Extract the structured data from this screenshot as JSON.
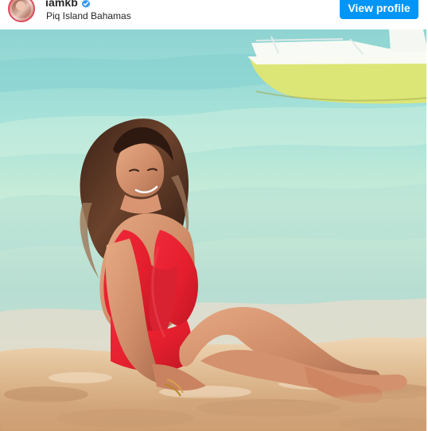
{
  "post": {
    "username": "iamkb",
    "location": "Piq Island Bahamas",
    "view_profile_label": "View profile"
  },
  "icons": {
    "verified": "verified-badge-icon",
    "avatar": "profile-avatar"
  },
  "colors": {
    "primary_button": "#0095f6",
    "verified_blue": "#3897f0",
    "swimsuit_red": "#e41f2d",
    "sand": "#d8b58a",
    "water": "#96d7d1",
    "boat": "#dce47a"
  }
}
